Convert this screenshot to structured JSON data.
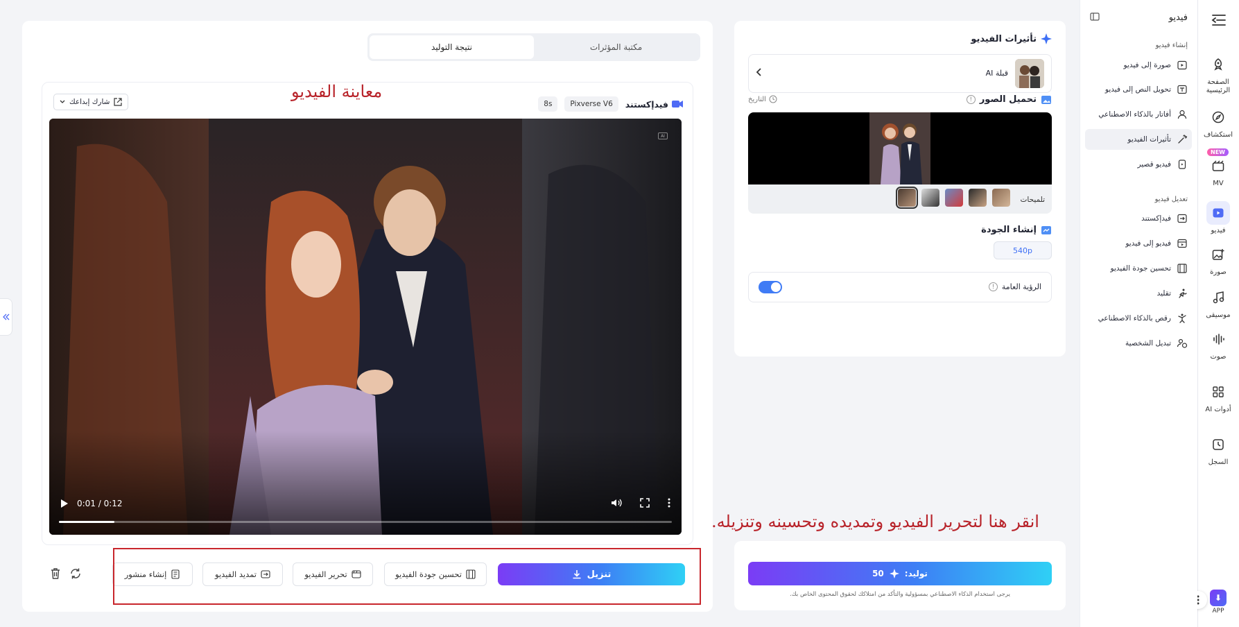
{
  "rail": {
    "items": [
      {
        "label": "الصفحة الرئيسية",
        "icon": "home-rocket-icon"
      },
      {
        "label": "استكشاف",
        "icon": "compass-icon"
      },
      {
        "label": "MV",
        "icon": "mv-icon",
        "badge": "NEW"
      },
      {
        "label": "فيديو",
        "icon": "video-icon"
      },
      {
        "label": "صورة",
        "icon": "image-icon"
      },
      {
        "label": "موسيقى",
        "icon": "music-icon"
      },
      {
        "label": "صوت",
        "icon": "sound-icon"
      },
      {
        "label": "أدوات AI",
        "icon": "tools-icon"
      },
      {
        "label": "السجل",
        "icon": "history-icon"
      }
    ],
    "app_label": "APP"
  },
  "menu": {
    "title": "فيديو",
    "section_create": "إنشاء فيديو",
    "section_edit": "تعديل فيديو",
    "create_items": [
      {
        "label": "صورة إلى فيديو",
        "icon": "image-to-video-icon"
      },
      {
        "label": "تحويل النص إلى فيديو",
        "icon": "text-to-video-icon"
      },
      {
        "label": "أفاتار بالذكاء الاصطناعي",
        "icon": "avatar-icon"
      },
      {
        "label": "تأثيرات الفيديو",
        "icon": "magic-wand-icon"
      },
      {
        "label": "فيديو قصير",
        "icon": "short-video-icon"
      }
    ],
    "edit_items": [
      {
        "label": "فيدإكستند",
        "icon": "extend-icon"
      },
      {
        "label": "فيديو إلى فيديو",
        "icon": "video-to-video-icon"
      },
      {
        "label": "تحسين جودة الفيديو",
        "icon": "upscale-icon"
      },
      {
        "label": "تقليد",
        "icon": "running-icon"
      },
      {
        "label": "رقص بالذكاء الاصطناعي",
        "icon": "dance-icon"
      },
      {
        "label": "تبديل الشخصية",
        "icon": "swap-person-icon"
      }
    ]
  },
  "settings": {
    "effects_title": "تأثيرات الفيديو",
    "effect_selected": "قبلة AI",
    "upload_title": "تحميل الصور",
    "history_label": "التاريخ",
    "hints_label": "تلميحات",
    "quality_title": "إنشاء الجودة",
    "quality_value": "540p",
    "public_label": "الرؤية العامة",
    "public_on": true,
    "generate_label": "توليد:",
    "generate_cost": "50",
    "disclaimer": "يرجى استخدام الذكاء الاصطناعي بمسؤولية والتأكد من امتلاكك لحقوق المحتوى الخاص بك."
  },
  "main": {
    "tabs": [
      {
        "label": "مكتبة المؤثرات",
        "active": false
      },
      {
        "label": "نتيجة التوليد",
        "active": true
      }
    ],
    "result_title": "فيدإكستند",
    "model_chip": "Pixverse V6",
    "duration_chip": "8s",
    "share_label": "شارك إبداعك",
    "video_time": "0:01 / 0:12",
    "video_progress": 0.09,
    "download_label": "تنزيل",
    "actions": [
      "تحسين جودة الفيديو",
      "تحرير الفيديو",
      "تمديد الفيديو",
      "إنشاء منشور"
    ]
  },
  "annotations": {
    "preview": "معاينة الفيديو",
    "hint": "انقر هنا لتحرير الفيديو وتمديده وتحسينه وتنزيله."
  },
  "colors": {
    "accent": "#4f6bf5",
    "annotation": "#b8232a",
    "toggle": "#3f7bf5"
  }
}
